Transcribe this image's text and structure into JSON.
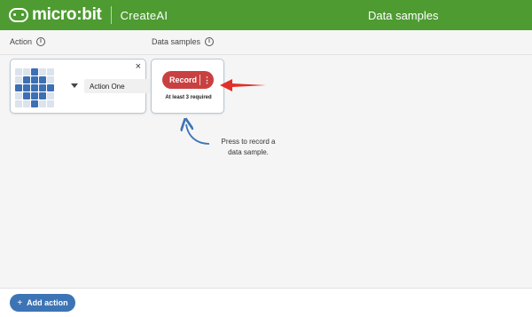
{
  "header": {
    "brand": "micro:bit",
    "product": "CreateAI",
    "title": "Data samples"
  },
  "columns": {
    "action_label": "Action",
    "samples_label": "Data samples",
    "info_glyph": "i"
  },
  "action_card": {
    "name_value": "Action One",
    "close_glyph": "×",
    "led_pattern": [
      [
        0,
        0,
        1,
        0,
        0
      ],
      [
        0,
        1,
        1,
        1,
        0
      ],
      [
        1,
        1,
        1,
        1,
        1
      ],
      [
        0,
        1,
        1,
        1,
        0
      ],
      [
        0,
        0,
        1,
        0,
        0
      ]
    ]
  },
  "sample_card": {
    "record_label": "Record",
    "more_glyph": "⋮",
    "required_text": "At least 3 required"
  },
  "hint": {
    "line1": "Press to record a",
    "line2": "data sample."
  },
  "footer": {
    "add_plus": "+",
    "add_label": "Add action"
  },
  "colors": {
    "header_green": "#4e9b32",
    "record_red": "#c94040",
    "add_blue": "#3d74b5",
    "led_on": "#3d6fb3",
    "arrow_red": "#e0302a",
    "hint_arrow_blue": "#3d74b5"
  }
}
